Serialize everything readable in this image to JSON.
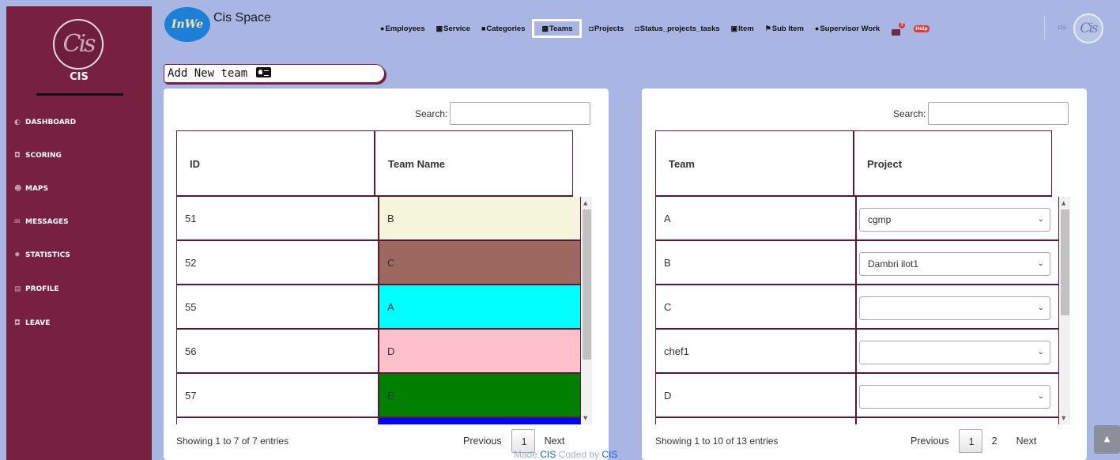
{
  "sidebar": {
    "logo_text": "Cis",
    "brand": "CIS",
    "items": [
      {
        "label": "DASHBOARD",
        "icon": "palette-icon"
      },
      {
        "label": "SCORING",
        "icon": "car-icon"
      },
      {
        "label": "MAPS",
        "icon": "people-icon"
      },
      {
        "label": "MESSAGES",
        "icon": "envelope-icon"
      },
      {
        "label": "STATISTICS",
        "icon": "gear-icon"
      },
      {
        "label": "PROFILE",
        "icon": "document-icon"
      },
      {
        "label": "LEAVE",
        "icon": "car-icon"
      }
    ]
  },
  "header": {
    "logo_text": "InWe",
    "app_title": "Cis Space",
    "nav": [
      {
        "label": "Employees",
        "icon": "user-icon"
      },
      {
        "label": "Service",
        "icon": "table-icon"
      },
      {
        "label": "Categories",
        "icon": "clipboard-icon"
      },
      {
        "label": "Teams",
        "icon": "table-icon",
        "active": true
      },
      {
        "label": "Projects",
        "icon": "car-icon"
      },
      {
        "label": "Status_projects_tasks",
        "icon": "car-icon"
      },
      {
        "label": "Item",
        "icon": "image-icon"
      },
      {
        "label": "Sub Item",
        "icon": "map-icon"
      },
      {
        "label": "Supervisor Work",
        "icon": "user-icon"
      }
    ],
    "mail_count": "7",
    "help_label": "Help",
    "user_name": "cis",
    "avatar_text": "Cis"
  },
  "add_team_label": "Add New team",
  "teams_table": {
    "search_label": "Search:",
    "columns": [
      "ID",
      "Team Name"
    ],
    "rows": [
      {
        "id": "51",
        "name": "B",
        "color": "#f5f5dc"
      },
      {
        "id": "52",
        "name": "C",
        "color": "#9c6860"
      },
      {
        "id": "55",
        "name": "A",
        "color": "#00ffff"
      },
      {
        "id": "56",
        "name": "D",
        "color": "#ffc0cb"
      },
      {
        "id": "57",
        "name": "E",
        "color": "#008000"
      }
    ],
    "next_row_color": "#0000ff",
    "info": "Showing 1 to 7 of 7 entries",
    "previous": "Previous",
    "pages": [
      "1"
    ],
    "next": "Next"
  },
  "projects_table": {
    "search_label": "Search:",
    "columns": [
      "Team",
      "Project"
    ],
    "rows": [
      {
        "team": "A",
        "project": "cgmp"
      },
      {
        "team": "B",
        "project": "Dambri ilot1"
      },
      {
        "team": "C",
        "project": ""
      },
      {
        "team": "chef1",
        "project": ""
      },
      {
        "team": "D",
        "project": ""
      }
    ],
    "info": "Showing 1 to 10 of 13 entries",
    "previous": "Previous",
    "pages": [
      "1",
      "2"
    ],
    "next": "Next"
  },
  "footer": {
    "prefix": "Made ",
    "link1": "CIS",
    "middle": " Coded by ",
    "link2": "CIS"
  }
}
